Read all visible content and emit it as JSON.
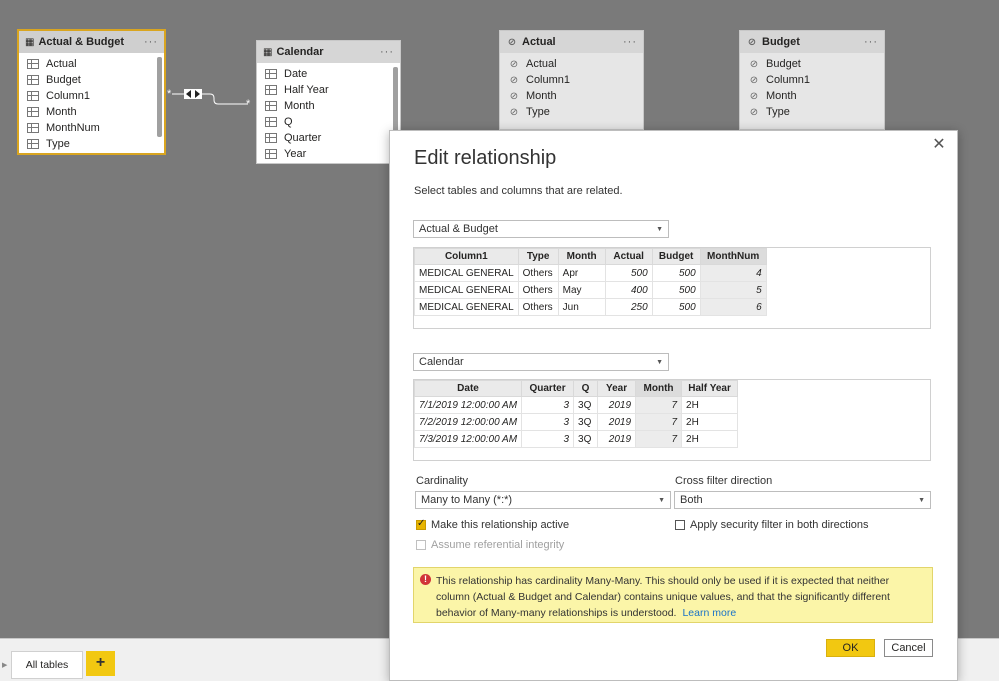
{
  "model_view": {
    "tables": {
      "actual_budget": {
        "title": "Actual & Budget",
        "fields": [
          "Actual",
          "Budget",
          "Column1",
          "Month",
          "MonthNum",
          "Type"
        ]
      },
      "calendar": {
        "title": "Calendar",
        "fields": [
          "Date",
          "Half Year",
          "Month",
          "Q",
          "Quarter",
          "Year"
        ]
      },
      "actual": {
        "title": "Actual",
        "fields": [
          "Actual",
          "Column1",
          "Month",
          "Type"
        ]
      },
      "budget": {
        "title": "Budget",
        "fields": [
          "Budget",
          "Column1",
          "Month",
          "Type"
        ]
      }
    },
    "more_label": "···",
    "relationship": {
      "from_card": "*",
      "to_card": "*"
    }
  },
  "dialog": {
    "title": "Edit relationship",
    "subtitle": "Select tables and columns that are related.",
    "close_glyph": "✕",
    "table1": {
      "selected": "Actual & Budget",
      "headers": [
        "Column1",
        "Type",
        "Month",
        "Actual",
        "Budget",
        "MonthNum"
      ],
      "rows": [
        [
          "MEDICAL GENERAL",
          "Others",
          "Apr",
          "500",
          "500",
          "4"
        ],
        [
          "MEDICAL GENERAL",
          "Others",
          "May",
          "400",
          "500",
          "5"
        ],
        [
          "MEDICAL GENERAL",
          "Others",
          "Jun",
          "250",
          "500",
          "6"
        ]
      ]
    },
    "table2": {
      "selected": "Calendar",
      "headers": [
        "Date",
        "Quarter",
        "Q",
        "Year",
        "Month",
        "Half Year"
      ],
      "rows": [
        [
          "7/1/2019 12:00:00 AM",
          "3",
          "3Q",
          "2019",
          "7",
          "2H"
        ],
        [
          "7/2/2019 12:00:00 AM",
          "3",
          "3Q",
          "2019",
          "7",
          "2H"
        ],
        [
          "7/3/2019 12:00:00 AM",
          "3",
          "3Q",
          "2019",
          "7",
          "2H"
        ]
      ]
    },
    "cardinality": {
      "label": "Cardinality",
      "value": "Many to Many (*:*)"
    },
    "cross_filter": {
      "label": "Cross filter direction",
      "value": "Both"
    },
    "make_active": {
      "label": "Make this relationship active",
      "checked": true
    },
    "security_filter": {
      "label": "Apply security filter in both directions",
      "checked": false
    },
    "referential": {
      "label": "Assume referential integrity",
      "disabled": true
    },
    "warning": {
      "icon": "!",
      "text": "This relationship has cardinality Many-Many. This should only be used if it is expected that neither column (Actual & Budget and Calendar) contains unique values, and that the significantly different behavior of Many-many relationships is understood.",
      "link": "Learn more"
    },
    "ok_label": "OK",
    "cancel_label": "Cancel"
  },
  "bottom_bar": {
    "tab_all": "All tables",
    "add_glyph": "+"
  },
  "colors": {
    "accent": "#f2c811",
    "selected_border": "#d9a520",
    "warning_bg": "#fbf5a8",
    "link": "#1a73c8"
  }
}
